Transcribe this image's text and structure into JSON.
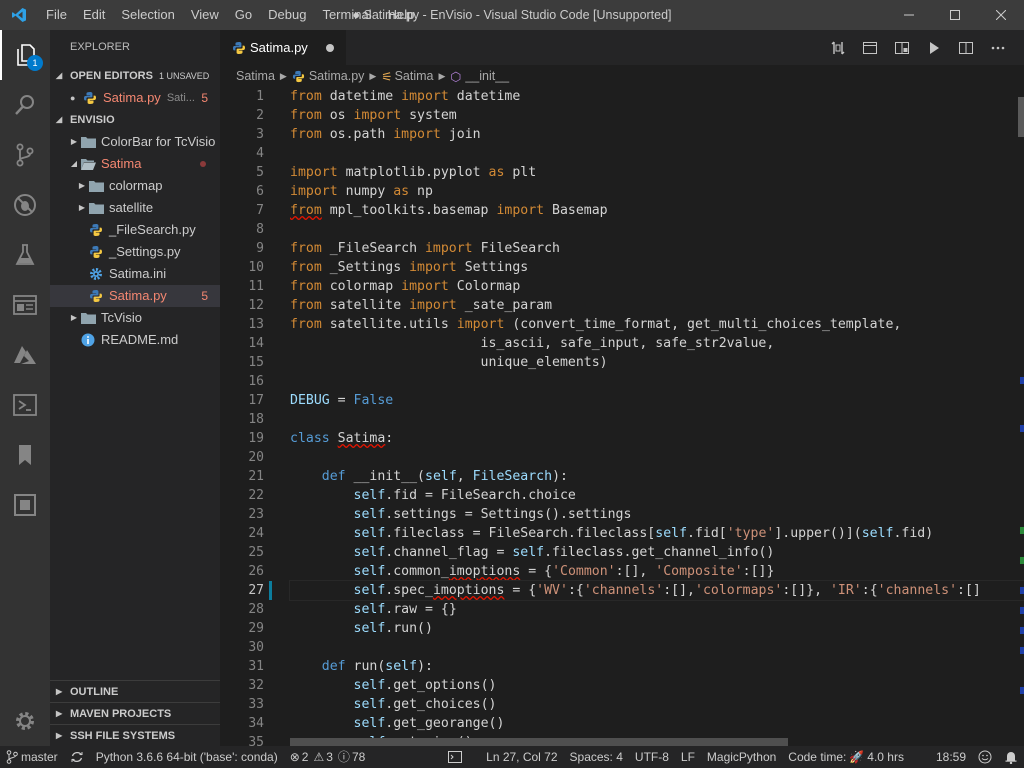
{
  "titlebar": {
    "menu": [
      "File",
      "Edit",
      "Selection",
      "View",
      "Go",
      "Debug",
      "Terminal",
      "Help"
    ],
    "title": "● Satima.py - EnVisio - Visual Studio Code [Unsupported]"
  },
  "activitybar": {
    "explorer_badge": "1"
  },
  "sidebar": {
    "title": "EXPLORER",
    "open_editors_label": "OPEN EDITORS",
    "unsaved_label": "1 UNSAVED",
    "open_editor": {
      "name": "Satima.py",
      "folder": "Sati...",
      "problems": "5"
    },
    "root_label": "ENVISIO",
    "tree": [
      {
        "label": "ColorBar for TcVisio",
        "kind": "folder",
        "expanded": false,
        "depth": 0
      },
      {
        "label": "Satima",
        "kind": "folder",
        "expanded": true,
        "depth": 0,
        "error": true
      },
      {
        "label": "colormap",
        "kind": "folder",
        "expanded": false,
        "depth": 1
      },
      {
        "label": "satellite",
        "kind": "folder",
        "expanded": false,
        "depth": 1
      },
      {
        "label": "_FileSearch.py",
        "kind": "python",
        "depth": 1
      },
      {
        "label": "_Settings.py",
        "kind": "python",
        "depth": 1
      },
      {
        "label": "Satima.ini",
        "kind": "ini",
        "depth": 1
      },
      {
        "label": "Satima.py",
        "kind": "python",
        "depth": 1,
        "error": true,
        "problems": "5",
        "selected": true
      },
      {
        "label": "TcVisio",
        "kind": "folder",
        "expanded": false,
        "depth": 0
      },
      {
        "label": "README.md",
        "kind": "info",
        "depth": 0
      }
    ],
    "bottom_sections": [
      "OUTLINE",
      "MAVEN PROJECTS",
      "SSH FILE SYSTEMS"
    ]
  },
  "tab": {
    "label": "Satima.py"
  },
  "breadcrumb": [
    "Satima",
    "Satima.py",
    "Satima",
    "__init__"
  ],
  "editor": {
    "current_line": 27,
    "line_numbers": [
      "1",
      "2",
      "3",
      "4",
      "5",
      "6",
      "7",
      "8",
      "9",
      "10",
      "11",
      "12",
      "13",
      "14",
      "15",
      "16",
      "17",
      "18",
      "19",
      "20",
      "21",
      "22",
      "23",
      "24",
      "25",
      "26",
      "27",
      "28",
      "29",
      "30",
      "31",
      "32",
      "33",
      "34",
      "35"
    ]
  },
  "statusbar": {
    "branch": "master",
    "interpreter": "Python 3.6.6 64-bit ('base': conda)",
    "errors": "2",
    "warnings": "3",
    "info": "78",
    "position": "Ln 27, Col 72",
    "spaces": "Spaces: 4",
    "encoding": "UTF-8",
    "eol": "LF",
    "language": "MagicPython",
    "code_time_label": "Code time:",
    "code_time": "4.0 hrs",
    "clock": "18:59"
  }
}
